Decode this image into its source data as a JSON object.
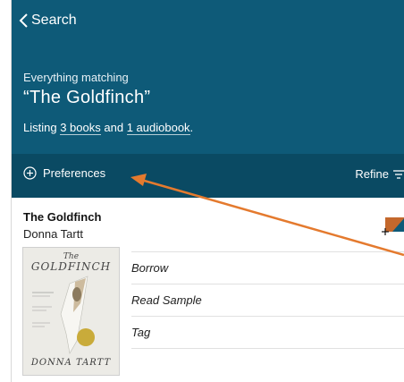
{
  "nav": {
    "back_label": "Search"
  },
  "header": {
    "eyebrow": "Everything matching",
    "query": "“The Goldfinch”",
    "listing": {
      "prefix": "Listing",
      "books": "3 books",
      "middle": "and",
      "audiobooks": "1 audiobook",
      "suffix": "."
    }
  },
  "toolbar": {
    "preferences_label": "Preferences",
    "refine_label": "Refine"
  },
  "result": {
    "title": "The Goldfinch",
    "author": "Donna Tartt",
    "cover": {
      "top_word": "The",
      "title_word": "GOLDFINCH",
      "author_word": "DONNA TARTT"
    },
    "actions": [
      "Borrow",
      "Read Sample",
      "Tag"
    ]
  },
  "colors": {
    "header_bg": "#0e5a78",
    "toolbar_bg": "#0a4a63",
    "arrow": "#e47a2e"
  },
  "icons": {
    "back": "chevron-left-icon",
    "preferences": "plus-circle-icon",
    "refine": "filter-icon",
    "tag": "add-tag-icon"
  }
}
